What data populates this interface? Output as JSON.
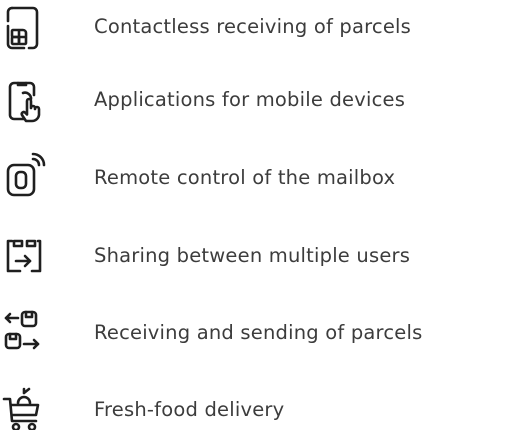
{
  "features": [
    {
      "icon": "tablet-grid-icon",
      "label": "Contactless receiving of parcels"
    },
    {
      "icon": "phone-touch-icon",
      "label": "Applications for mobile devices"
    },
    {
      "icon": "mailbox-signal-icon",
      "label": "Remote control of the mailbox"
    },
    {
      "icon": "share-arrow-icon",
      "label": "Sharing between multiple users"
    },
    {
      "icon": "mailbox-exchange-icon",
      "label": "Receiving and sending of parcels"
    },
    {
      "icon": "food-basket-icon",
      "label": "Fresh-food delivery"
    }
  ],
  "colors": {
    "text": "#3c3c3c",
    "icon_stroke": "#1f1f1f",
    "background": "#ffffff"
  }
}
